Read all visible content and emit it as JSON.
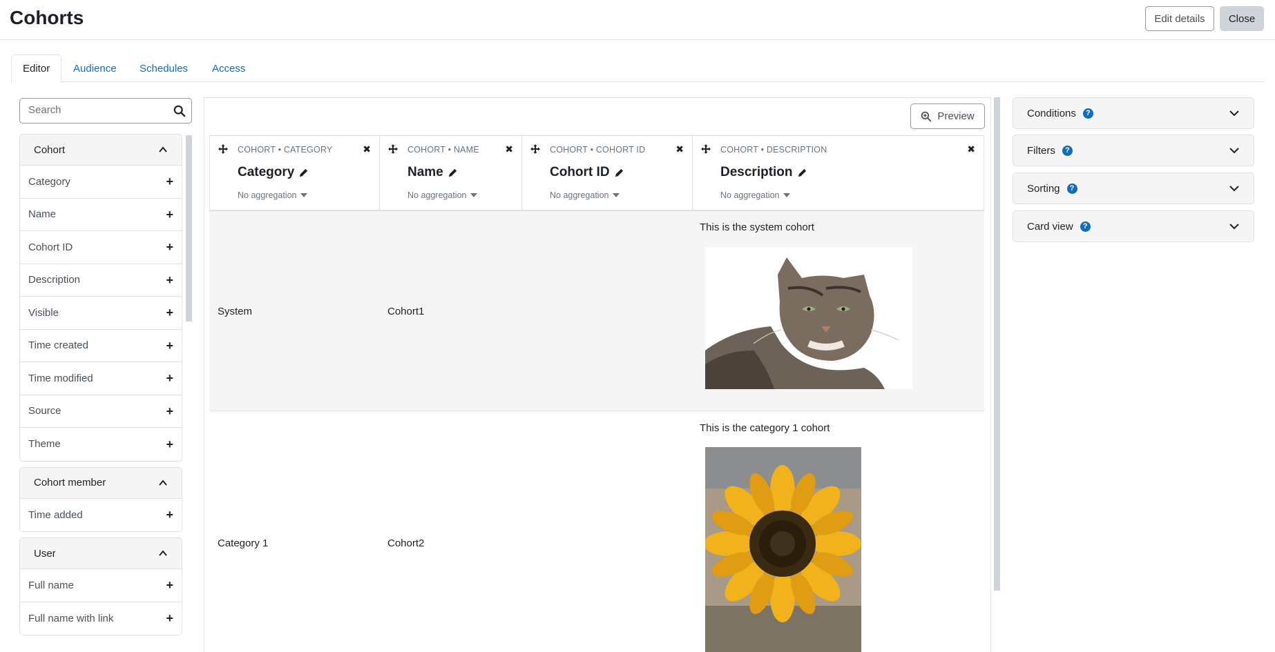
{
  "header": {
    "title": "Cohorts",
    "edit_details_label": "Edit details",
    "close_label": "Close"
  },
  "tabs": [
    {
      "label": "Editor",
      "active": true
    },
    {
      "label": "Audience",
      "active": false
    },
    {
      "label": "Schedules",
      "active": false
    },
    {
      "label": "Access",
      "active": false
    }
  ],
  "sidebar": {
    "search_placeholder": "Search",
    "groups": [
      {
        "title": "Cohort",
        "items": [
          "Category",
          "Name",
          "Cohort ID",
          "Description",
          "Visible",
          "Time created",
          "Time modified",
          "Source",
          "Theme"
        ]
      },
      {
        "title": "Cohort member",
        "items": [
          "Time added"
        ]
      },
      {
        "title": "User",
        "items": [
          "Full name",
          "Full name with link"
        ]
      }
    ]
  },
  "main": {
    "preview_label": "Preview",
    "columns": [
      {
        "crumb": "COHORT • CATEGORY",
        "name": "Category",
        "aggregation": "No aggregation"
      },
      {
        "crumb": "COHORT • NAME",
        "name": "Name",
        "aggregation": "No aggregation"
      },
      {
        "crumb": "COHORT • COHORT ID",
        "name": "Cohort ID",
        "aggregation": "No aggregation"
      },
      {
        "crumb": "COHORT • DESCRIPTION",
        "name": "Description",
        "aggregation": "No aggregation"
      }
    ],
    "rows": [
      {
        "category": "System",
        "name": "Cohort1",
        "cohort_id": "",
        "description": "This is the system cohort"
      },
      {
        "category": "Category 1",
        "name": "Cohort2",
        "cohort_id": "",
        "description": "This is the category 1 cohort"
      }
    ]
  },
  "right_panels": [
    {
      "label": "Conditions"
    },
    {
      "label": "Filters"
    },
    {
      "label": "Sorting"
    },
    {
      "label": "Card view"
    }
  ],
  "colors": {
    "link": "#0f6cbf",
    "border": "#dee2e6",
    "muted": "#6a737b",
    "panel_bg": "#f5f5f5"
  }
}
